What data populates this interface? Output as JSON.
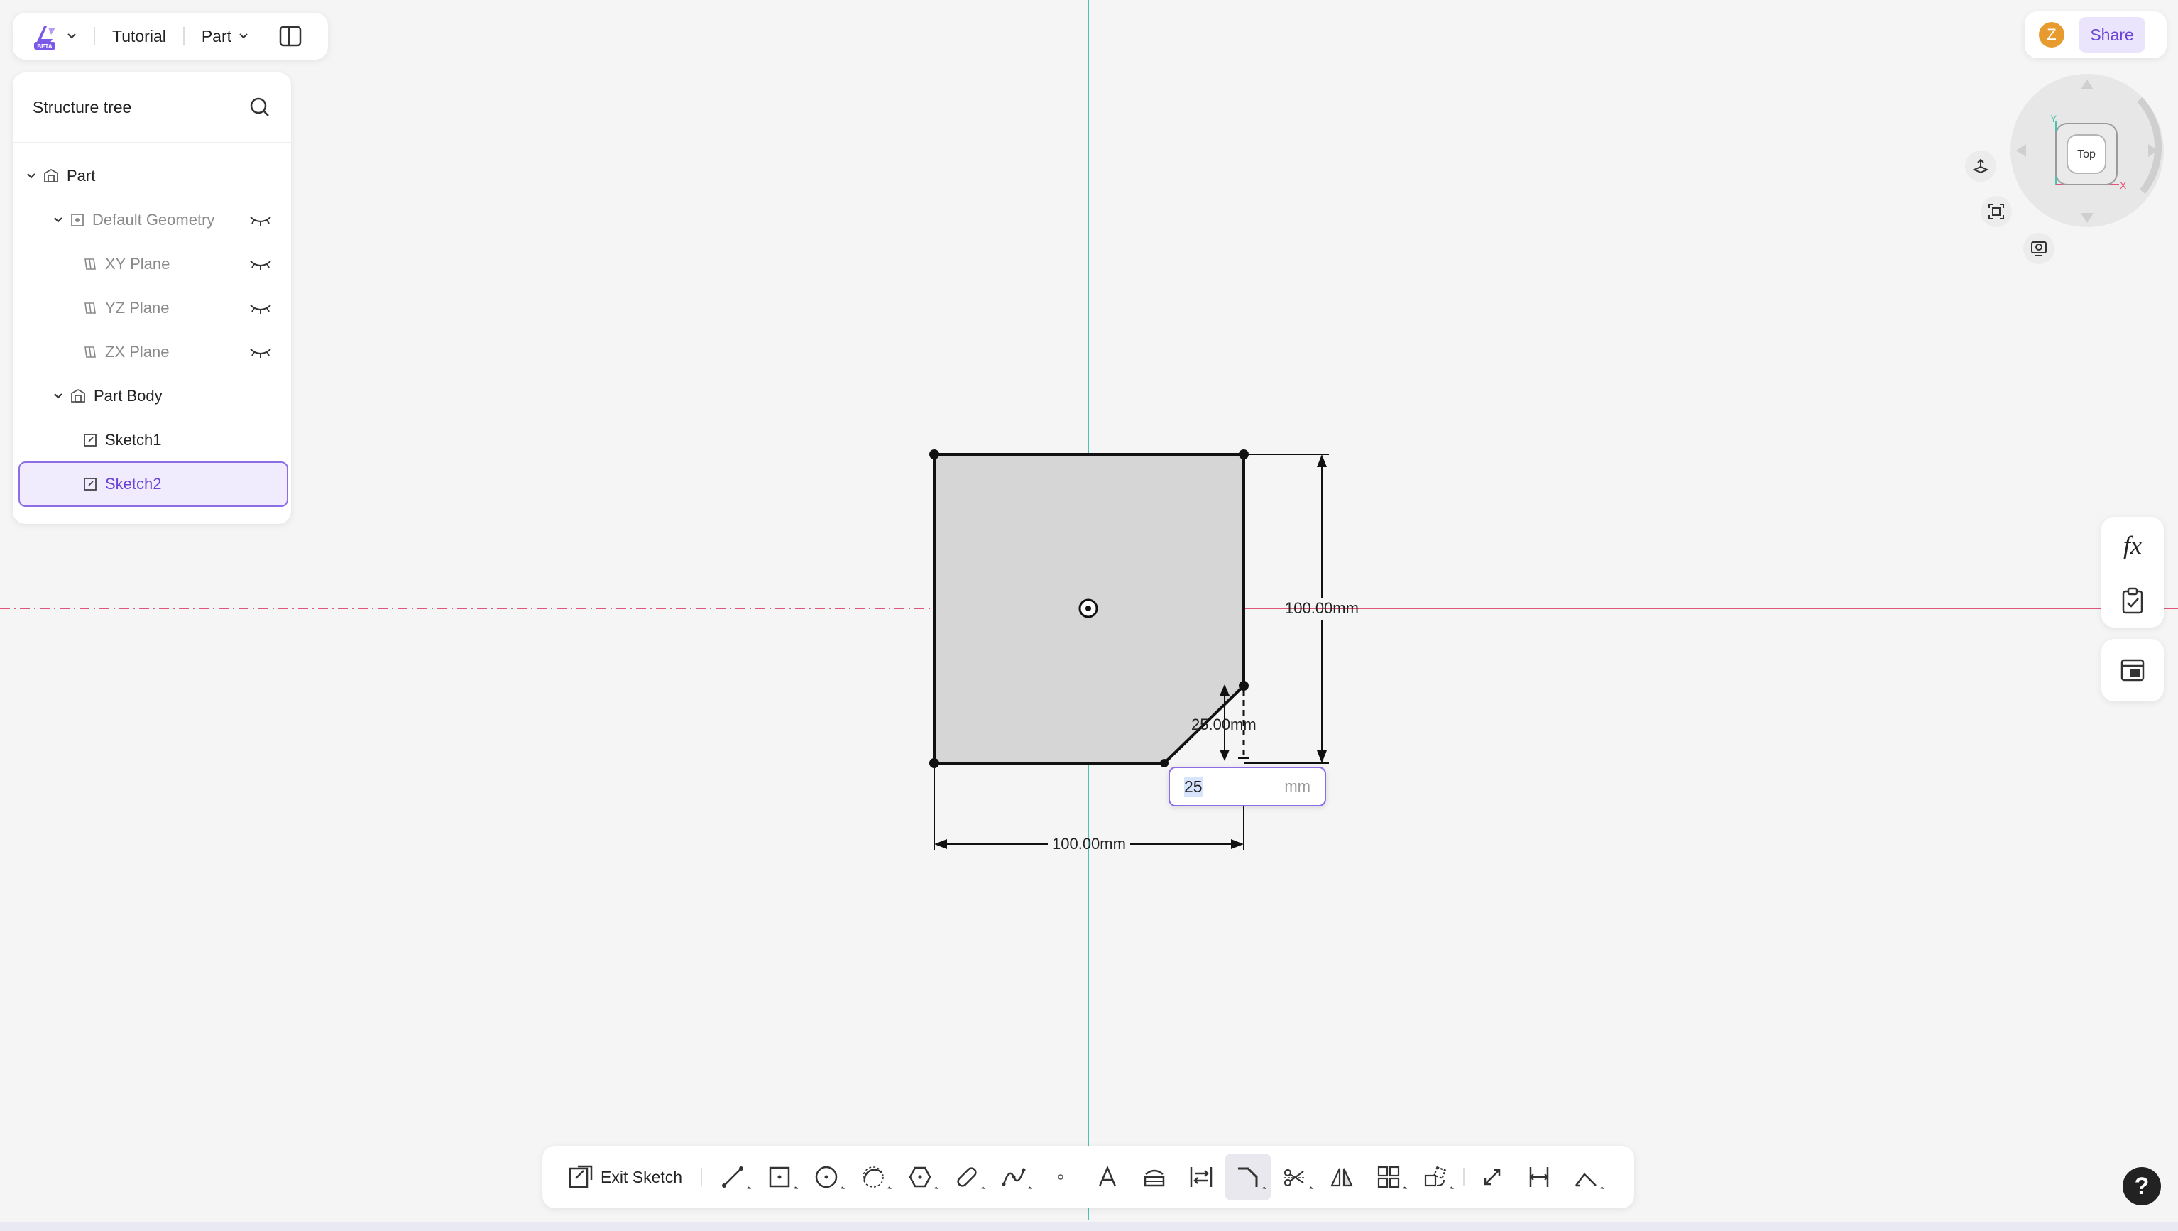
{
  "topbar": {
    "beta_badge": "BETA",
    "doc_name": "Tutorial",
    "mode": "Part"
  },
  "tree": {
    "title": "Structure tree",
    "items": [
      {
        "label": "Part"
      },
      {
        "label": "Default Geometry"
      },
      {
        "label": "XY Plane"
      },
      {
        "label": "YZ Plane"
      },
      {
        "label": "ZX Plane"
      },
      {
        "label": "Part Body"
      },
      {
        "label": "Sketch1"
      },
      {
        "label": "Sketch2"
      }
    ]
  },
  "header_right": {
    "avatar_initial": "Z",
    "share_label": "Share"
  },
  "view_cube": {
    "face": "Top",
    "axis_x": "X",
    "axis_y": "Y"
  },
  "sketch": {
    "dim_height": "100.00mm",
    "dim_width": "100.00mm",
    "dim_chamfer": "25.00mm",
    "input_value": "25",
    "input_unit": "mm"
  },
  "right_tools": {
    "formula_label": "fx"
  },
  "toolbar": {
    "exit_label": "Exit Sketch",
    "tools": [
      "line-tool",
      "rectangle-tool",
      "circle-tool",
      "arc-tool",
      "polygon-tool",
      "slot-tool",
      "spline-tool",
      "point-tool",
      "text-tool",
      "project-tool",
      "convert-tool",
      "fillet-chamfer-tool",
      "trim-tool",
      "mirror-tool",
      "pattern-tool",
      "transform-tool",
      "offset-tool",
      "dimension-tool",
      "constraint-tool"
    ]
  },
  "help": {
    "label": "?"
  },
  "colors": {
    "accent": "#8c6de6",
    "x_axis": "#e0567a",
    "y_axis": "#49c4b2",
    "shape_fill": "#d6d6d6"
  }
}
